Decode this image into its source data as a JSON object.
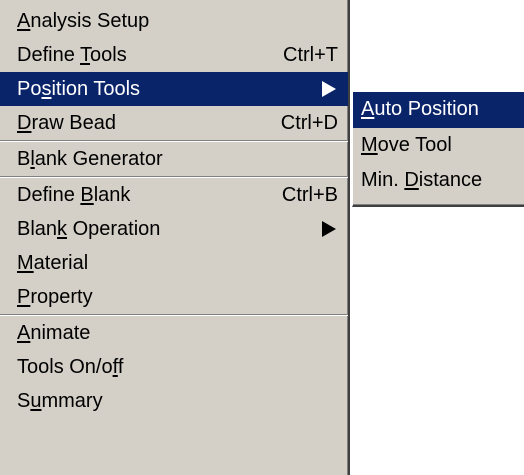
{
  "main_menu": {
    "items": [
      {
        "pre": "",
        "key": "A",
        "post": "nalysis Setup",
        "shortcut": ""
      },
      {
        "pre": "Define ",
        "key": "T",
        "post": "ools",
        "shortcut": "Ctrl+T"
      },
      {
        "pre": "Po",
        "key": "s",
        "post": "ition Tools",
        "shortcut": ""
      },
      {
        "pre": "",
        "key": "D",
        "post": "raw Bead",
        "shortcut": "Ctrl+D"
      },
      {
        "pre": "B",
        "key": "l",
        "post": "ank Generator",
        "shortcut": ""
      },
      {
        "pre": "Define ",
        "key": "B",
        "post": "lank",
        "shortcut": "Ctrl+B"
      },
      {
        "pre": "Blan",
        "key": "k",
        "post": " Operation",
        "shortcut": ""
      },
      {
        "pre": "",
        "key": "M",
        "post": "aterial",
        "shortcut": ""
      },
      {
        "pre": "",
        "key": "P",
        "post": "roperty",
        "shortcut": ""
      },
      {
        "pre": "",
        "key": "A",
        "post": "nimate",
        "shortcut": ""
      },
      {
        "pre": "Tools On/o",
        "key": "f",
        "post": "f",
        "shortcut": ""
      },
      {
        "pre": "S",
        "key": "u",
        "post": "mmary",
        "shortcut": ""
      }
    ]
  },
  "sub_menu": {
    "items": [
      {
        "pre": "",
        "key": "A",
        "post": "uto Position"
      },
      {
        "pre": "",
        "key": "M",
        "post": "ove Tool"
      },
      {
        "pre": "Min. ",
        "key": "D",
        "post": "istance"
      }
    ]
  },
  "colors": {
    "menu_bg": "#d4d0c8",
    "highlight": "#0a246a",
    "highlight_text": "#ffffff"
  }
}
